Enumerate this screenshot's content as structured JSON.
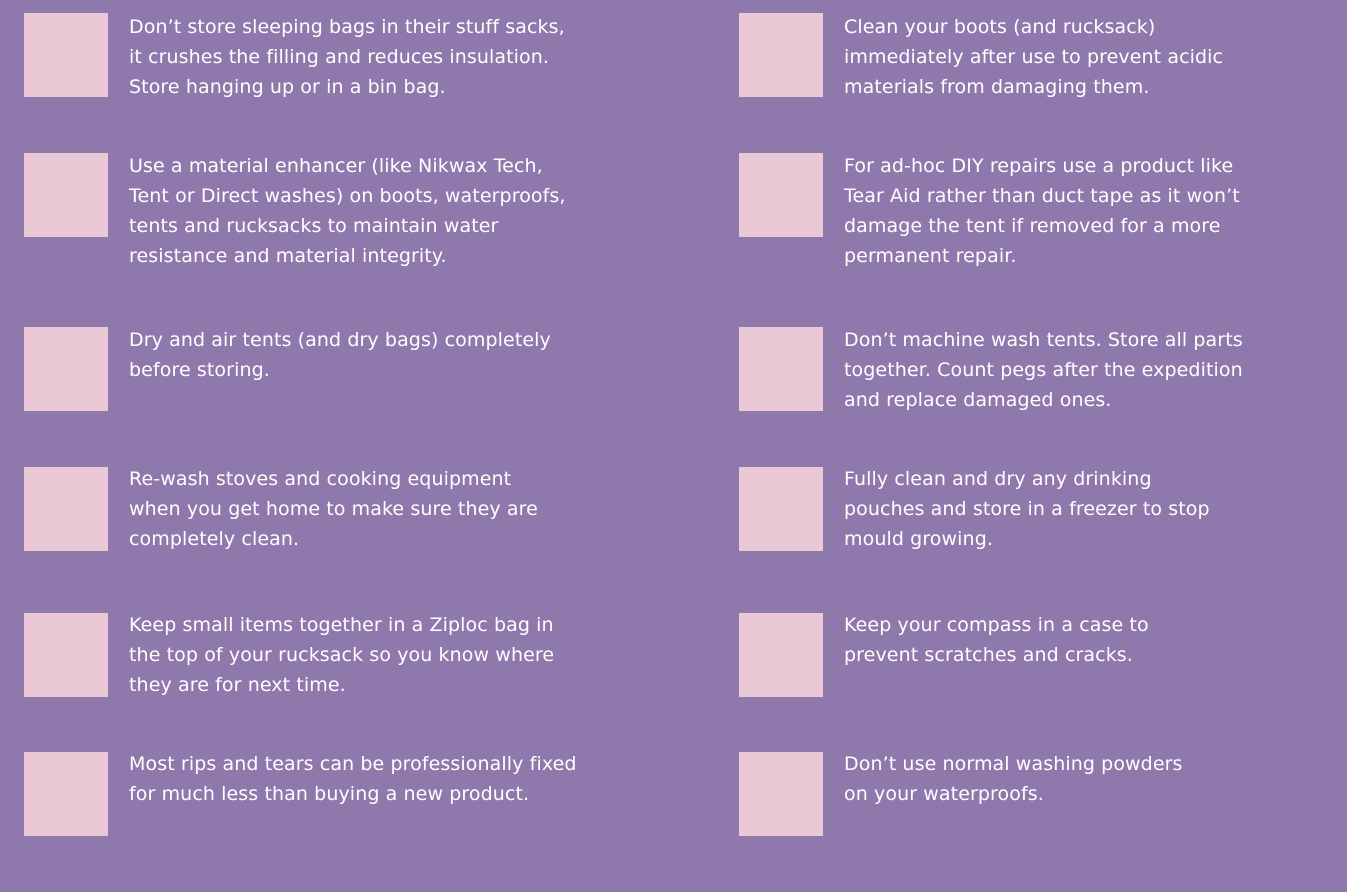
{
  "background_color": "#8f78ac",
  "checkbox_color": "#ebc8d6",
  "tips": {
    "left": [
      {
        "text": "Don’t store sleeping bags in their stuff sacks,\nit crushes the filling and reduces insulation.\nStore hanging up or in a bin bag."
      },
      {
        "text": "Use a material enhancer (like Nikwax Tech,\nTent or Direct washes) on boots, waterproofs,\ntents and rucksacks to maintain water\nresistance and material integrity."
      },
      {
        "text": "Dry and air tents (and dry bags) completely\nbefore storing."
      },
      {
        "text": "Re-wash stoves and cooking equipment\nwhen you get home to make sure they are\ncompletely clean."
      },
      {
        "text": "Keep small items together in a Ziploc bag in\nthe top of your rucksack so you know where\nthey are for next time."
      },
      {
        "text": "Most rips and tears can be professionally fixed\nfor much less than buying a new product."
      }
    ],
    "right": [
      {
        "text": "Clean your boots (and rucksack)\nimmediately after use to prevent acidic\nmaterials from damaging them."
      },
      {
        "text": "For ad-hoc DIY repairs use a product like\nTear Aid rather than duct tape as it won’t\ndamage the tent if removed for a more\npermanent repair."
      },
      {
        "text": "Don’t machine wash tents. Store all parts\ntogether. Count pegs after the expedition\nand replace damaged ones."
      },
      {
        "text": "Fully clean and dry any drinking\npouches and store in a freezer to stop\nmould growing."
      },
      {
        "text": "Keep your compass in a case to\nprevent scratches and cracks."
      },
      {
        "text": "Don’t use normal washing powders\non your waterproofs."
      }
    ]
  }
}
